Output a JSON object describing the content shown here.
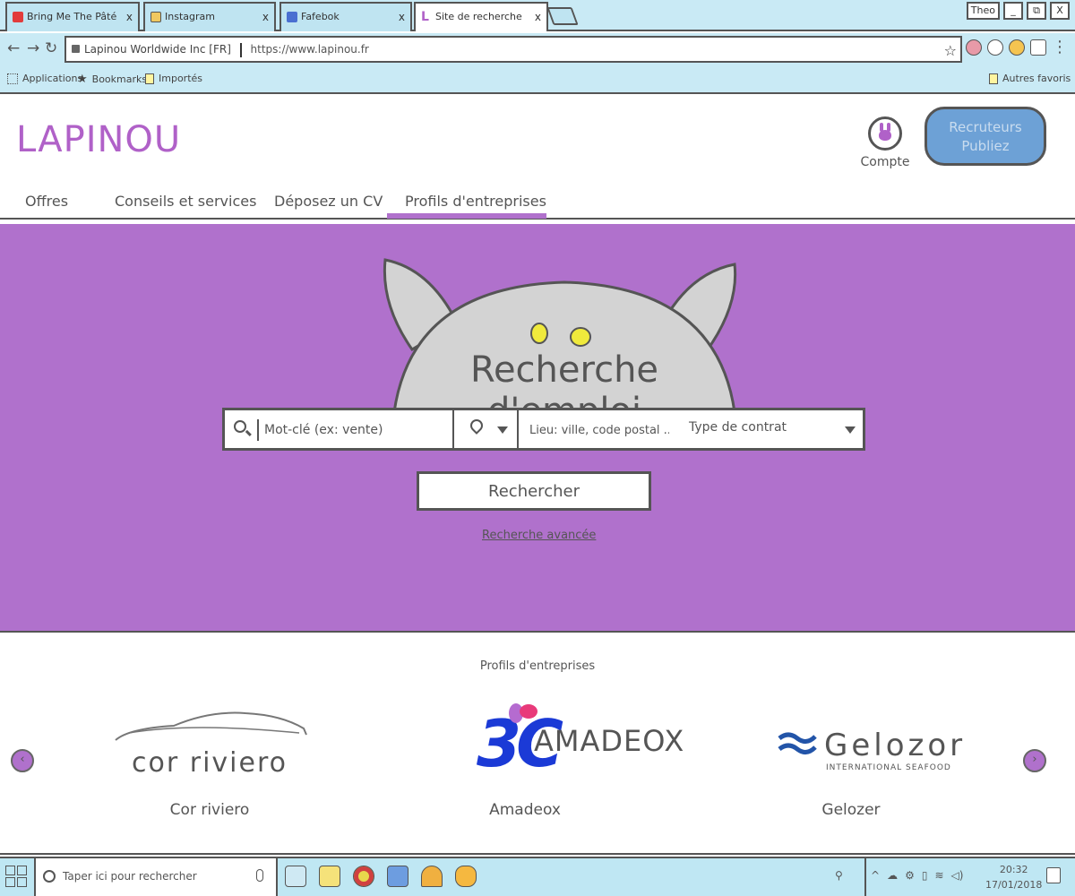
{
  "browser": {
    "tabs": [
      {
        "title": "Bring Me The Pâté",
        "color": "#e23b3b"
      },
      {
        "title": "Instagram",
        "color": "#f0c860"
      },
      {
        "title": "Fafebok",
        "color": "#4a6fd1"
      },
      {
        "title": "Site de recherche d'emp",
        "color": "#b061c8"
      }
    ],
    "tab_close": "x",
    "window_user": "Theo",
    "window_minimize": "_",
    "window_maximize": "⧉",
    "window_close": "X",
    "site_name": "Lapinou Worldwide Inc [FR]",
    "url": "https://www.lapinou.fr",
    "bookmarks": [
      "Applications",
      "Bookmarks",
      "Importés"
    ],
    "other_bookmarks": "Autres favoris"
  },
  "site": {
    "logo": "LAPINOU",
    "account_label": "Compte",
    "recruiters_cta": "Recruteurs Publiez",
    "nav": [
      "Offres",
      "Conseils et services",
      "Déposez un CV",
      "Profils d'entreprises"
    ],
    "hero_title": "Recherche d'emploi",
    "search": {
      "keyword_placeholder": "Mot-clé (ex: vente)",
      "location_placeholder": "Lieu: ville, code postal ...",
      "contract_type": "Type de contrat",
      "button": "Rechercher",
      "advanced": "Recherche avancée"
    },
    "companies_title": "Profils d'entreprises",
    "companies": [
      {
        "name": "Cor riviero",
        "logo_text": "cor riviero"
      },
      {
        "name": "Amadeox",
        "logo_text": "AMADEOX",
        "logo_mark": "3C"
      },
      {
        "name": "Gelozer",
        "logo_text": "Gelozor",
        "logo_sub": "INTERNATIONAL SEAFOOD"
      }
    ],
    "colors": {
      "brand": "#b061c8",
      "hero": "#b071cc",
      "cta": "#6da1d6"
    }
  },
  "taskbar": {
    "search_placeholder": "Taper ici pour rechercher",
    "time": "20:32",
    "date": "17/01/2018"
  }
}
